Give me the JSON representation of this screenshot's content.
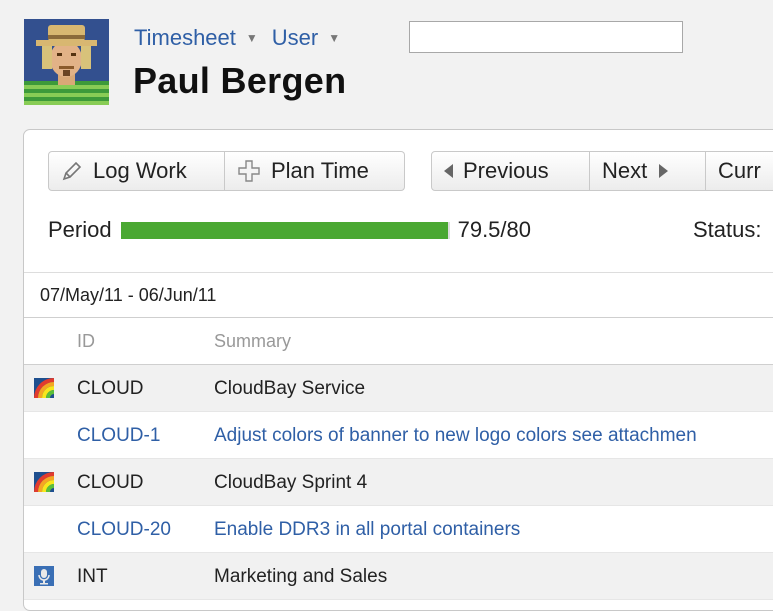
{
  "nav": {
    "timesheet_label": "Timesheet",
    "user_label": "User",
    "user_search_value": ""
  },
  "user": {
    "name": "Paul Bergen"
  },
  "toolbar": {
    "log_work_label": "Log Work",
    "plan_time_label": "Plan Time",
    "previous_label": "Previous",
    "next_label": "Next",
    "current_label": "Curr"
  },
  "period": {
    "label": "Period",
    "logged": 79.5,
    "target": 80,
    "value_text": "79.5/80",
    "status_label": "Status:"
  },
  "date_range": "07/May/11 - 06/Jun/11",
  "table": {
    "headers": {
      "id": "ID",
      "summary": "Summary"
    },
    "rows": [
      {
        "type": "project",
        "icon": "rainbow-project-icon",
        "id": "CLOUD",
        "summary": "CloudBay Service"
      },
      {
        "type": "issue",
        "icon": "",
        "id": "CLOUD-1",
        "summary": "Adjust colors of banner to new logo colors see attachmen"
      },
      {
        "type": "project",
        "icon": "rainbow-project-icon",
        "id": "CLOUD",
        "summary": "CloudBay Sprint 4"
      },
      {
        "type": "issue",
        "icon": "",
        "id": "CLOUD-20",
        "summary": "Enable DDR3 in all portal containers"
      },
      {
        "type": "project",
        "icon": "microphone-project-icon",
        "id": "INT",
        "summary": "Marketing and Sales"
      }
    ]
  },
  "colors": {
    "link": "#2f5fa6",
    "progress": "#4aa832",
    "project_row_bg": "#f1f1f1"
  }
}
